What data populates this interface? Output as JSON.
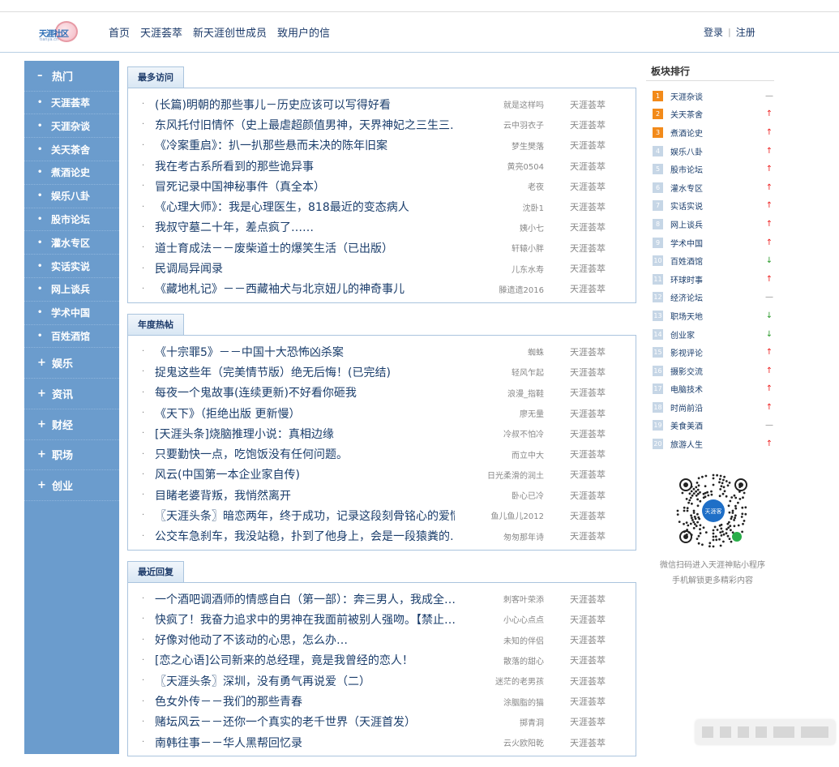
{
  "nav": [
    "首页",
    "天涯荟萃",
    "新天涯创世成员",
    "致用户的信"
  ],
  "auth": {
    "login": "登录",
    "sep": "|",
    "register": "注册"
  },
  "logo": {
    "text": "天涯社区",
    "sub": "tianya.cn"
  },
  "sidebar": {
    "hot_label": "热门",
    "hot_items": [
      "天涯荟萃",
      "天涯杂谈",
      "关天茶舍",
      "煮酒论史",
      "娱乐八卦",
      "股市论坛",
      "灌水专区",
      "实话实说",
      "网上谈兵",
      "学术中国",
      "百姓酒馆"
    ],
    "groups": [
      "娱乐",
      "资讯",
      "财经",
      "职场",
      "创业"
    ]
  },
  "sections": [
    {
      "title": "最多访问",
      "rows": [
        {
          "title": "(长篇)明朝的那些事儿－历史应该可以写得好看",
          "author": "就是这样吗",
          "board": "天涯荟萃"
        },
        {
          "title": "东风托付旧情怀（史上最虐超颜值男神，天界神妃之三生三…",
          "author": "云中羽衣子",
          "board": "天涯荟萃"
        },
        {
          "title": "《冷案重启》：扒一扒那些悬而未决的陈年旧案",
          "author": "梦生樊落",
          "board": "天涯荟萃"
        },
        {
          "title": "我在考古系所看到的那些诡异事",
          "author": "黄亮0504",
          "board": "天涯荟萃"
        },
        {
          "title": "冒死记录中国神秘事件（真全本）",
          "author": "老夜",
          "board": "天涯荟萃"
        },
        {
          "title": "《心理大师》：我是心理医生，818最近的变态病人",
          "author": "沈卧1",
          "board": "天涯荟萃"
        },
        {
          "title": "我叔守墓二十年，差点疯了……",
          "author": "姨小七",
          "board": "天涯荟萃"
        },
        {
          "title": "道士育成法－－废柴道士的爆笑生活（已出版）",
          "author": "轩辕小胖",
          "board": "天涯荟萃"
        },
        {
          "title": "民调局异闻录",
          "author": "儿东水寿",
          "board": "天涯荟萃"
        },
        {
          "title": "《藏地札记》－－西藏袖犬与北京妞儿的神奇事儿",
          "author": "滕遗遗2016",
          "board": "天涯荟萃"
        }
      ]
    },
    {
      "title": "年度热帖",
      "rows": [
        {
          "title": "《十宗罪5》－－中国十大恐怖凶杀案",
          "author": "蜘蛛",
          "board": "天涯荟萃"
        },
        {
          "title": "捉鬼这些年（完美情节版）绝无后悔！(已完结)",
          "author": "轻风乍起",
          "board": "天涯荟萃"
        },
        {
          "title": "每夜一个鬼故事(连续更新)不好看你砸我",
          "author": "浪漫_指鞋",
          "board": "天涯荟萃"
        },
        {
          "title": "《天下》（拒绝出版 更新慢）",
          "author": "廖无量",
          "board": "天涯荟萃"
        },
        {
          "title": "[天涯头条]烧脑推理小说：真相边缘",
          "author": "冷叔不怕冷",
          "board": "天涯荟萃"
        },
        {
          "title": "只要勤快一点，吃饱饭没有任何问题。",
          "author": "而立中大",
          "board": "天涯荟萃"
        },
        {
          "title": "风云(中国第一本企业家自传)",
          "author": "日光柔滑的润土",
          "board": "天涯荟萃"
        },
        {
          "title": "目睹老婆背叛，我悄然离开",
          "author": "卧心已冷",
          "board": "天涯荟萃"
        },
        {
          "title": "〖天涯头条〗暗恋两年，终于成功，记录这段刻骨铭心的爱情",
          "author": "鱼儿鱼儿2012",
          "board": "天涯荟萃"
        },
        {
          "title": "公交车急刹车，我没站稳，扑到了他身上，会是一段猿粪的…",
          "author": "匆匆那年诗",
          "board": "天涯荟萃"
        }
      ]
    },
    {
      "title": "最近回复",
      "rows": [
        {
          "title": "一个酒吧调酒师的情感自白（第一部）：奔三男人，我成全…",
          "author": "刺客叶荣添",
          "board": "天涯荟萃"
        },
        {
          "title": "快疯了！我奋力追求中的男神在我面前被别人强吻。【禁止…",
          "author": "小心心点点",
          "board": "天涯荟萃"
        },
        {
          "title": "好像对他动了不该动的心思，怎么办…",
          "author": "未知的伴侣",
          "board": "天涯荟萃"
        },
        {
          "title": "[恋之心语]公司新来的总经理，竟是我曾经的恋人！",
          "author": "散落的甜心",
          "board": "天涯荟萃"
        },
        {
          "title": "〖天涯头条〗深圳，没有勇气再说爱（二）",
          "author": "迷茫的老男孩",
          "board": "天涯荟萃"
        },
        {
          "title": "色女外传－－我们的那些青春",
          "author": "涂胭脂的猫",
          "board": "天涯荟萃"
        },
        {
          "title": "赌坛风云－－还你一个真实的老千世界（天涯首发）",
          "author": "掷青洞",
          "board": "天涯荟萃"
        },
        {
          "title": "南韩往事－－华人黑帮回忆录",
          "author": "云火欧阳乾",
          "board": "天涯荟萃"
        }
      ]
    }
  ],
  "rank": {
    "title": "板块排行",
    "items": [
      {
        "num": "1",
        "name": "天涯杂谈",
        "trend": "flat"
      },
      {
        "num": "2",
        "name": "关天茶舍",
        "trend": "up"
      },
      {
        "num": "3",
        "name": "煮酒论史",
        "trend": "up"
      },
      {
        "num": "4",
        "name": "娱乐八卦",
        "trend": "up"
      },
      {
        "num": "5",
        "name": "股市论坛",
        "trend": "up"
      },
      {
        "num": "6",
        "name": "灌水专区",
        "trend": "up"
      },
      {
        "num": "7",
        "name": "实话实说",
        "trend": "up"
      },
      {
        "num": "8",
        "name": "网上谈兵",
        "trend": "up"
      },
      {
        "num": "9",
        "name": "学术中国",
        "trend": "up"
      },
      {
        "num": "10",
        "name": "百姓酒馆",
        "trend": "down"
      },
      {
        "num": "11",
        "name": "环球时事",
        "trend": "up"
      },
      {
        "num": "12",
        "name": "经济论坛",
        "trend": "flat"
      },
      {
        "num": "13",
        "name": "职场天地",
        "trend": "down"
      },
      {
        "num": "14",
        "name": "创业家",
        "trend": "down"
      },
      {
        "num": "15",
        "name": "影视评论",
        "trend": "up"
      },
      {
        "num": "16",
        "name": "摄影交流",
        "trend": "up"
      },
      {
        "num": "17",
        "name": "电脑技术",
        "trend": "up"
      },
      {
        "num": "18",
        "name": "时尚前沿",
        "trend": "up"
      },
      {
        "num": "19",
        "name": "美食美酒",
        "trend": "flat"
      },
      {
        "num": "20",
        "name": "旅游人生",
        "trend": "up"
      }
    ],
    "qr_caption_1": "微信扫码进入天涯神贴小程序",
    "qr_caption_2": "手机解锁更多精彩内容",
    "qr_badge": "天涯客"
  },
  "colors": {
    "sidebar": "#6b9ccd",
    "accent": "#f28a1a",
    "up": "#e22222",
    "down": "#2a9a2a"
  }
}
